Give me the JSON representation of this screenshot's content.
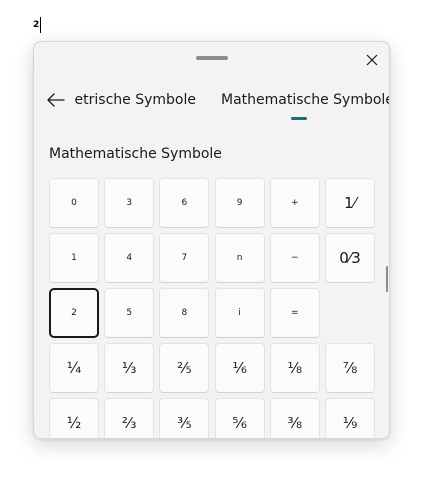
{
  "document": {
    "typed_text": "2"
  },
  "panel": {
    "close_icon": "close-icon",
    "back_icon": "back-arrow-icon",
    "tabs": [
      {
        "label": "Mathematische Symbole",
        "visible_fragment": "ıetrische Symbole"
      },
      {
        "label": "Mathematische Symbole",
        "selected": true
      }
    ],
    "accent_color": "#1f6d6a",
    "section_title": "Mathematische Symbole",
    "keys": [
      {
        "label": "0"
      },
      {
        "label": "3"
      },
      {
        "label": "6"
      },
      {
        "label": "9"
      },
      {
        "label": "+"
      },
      {
        "label": "1⁄"
      },
      {
        "label": "1"
      },
      {
        "label": "4"
      },
      {
        "label": "7"
      },
      {
        "label": "n"
      },
      {
        "label": "−"
      },
      {
        "label": "0⁄3"
      },
      {
        "label": "2",
        "selected": true
      },
      {
        "label": "5"
      },
      {
        "label": "8"
      },
      {
        "label": "i"
      },
      {
        "label": "="
      },
      {
        "label": ""
      },
      {
        "label": "¼"
      },
      {
        "label": "⅓"
      },
      {
        "label": "⅖"
      },
      {
        "label": "⅙"
      },
      {
        "label": "⅛"
      },
      {
        "label": "⅞"
      },
      {
        "label": "½"
      },
      {
        "label": "⅔"
      },
      {
        "label": "⅗"
      },
      {
        "label": "⅚"
      },
      {
        "label": "⅜"
      },
      {
        "label": "⅑"
      }
    ]
  }
}
